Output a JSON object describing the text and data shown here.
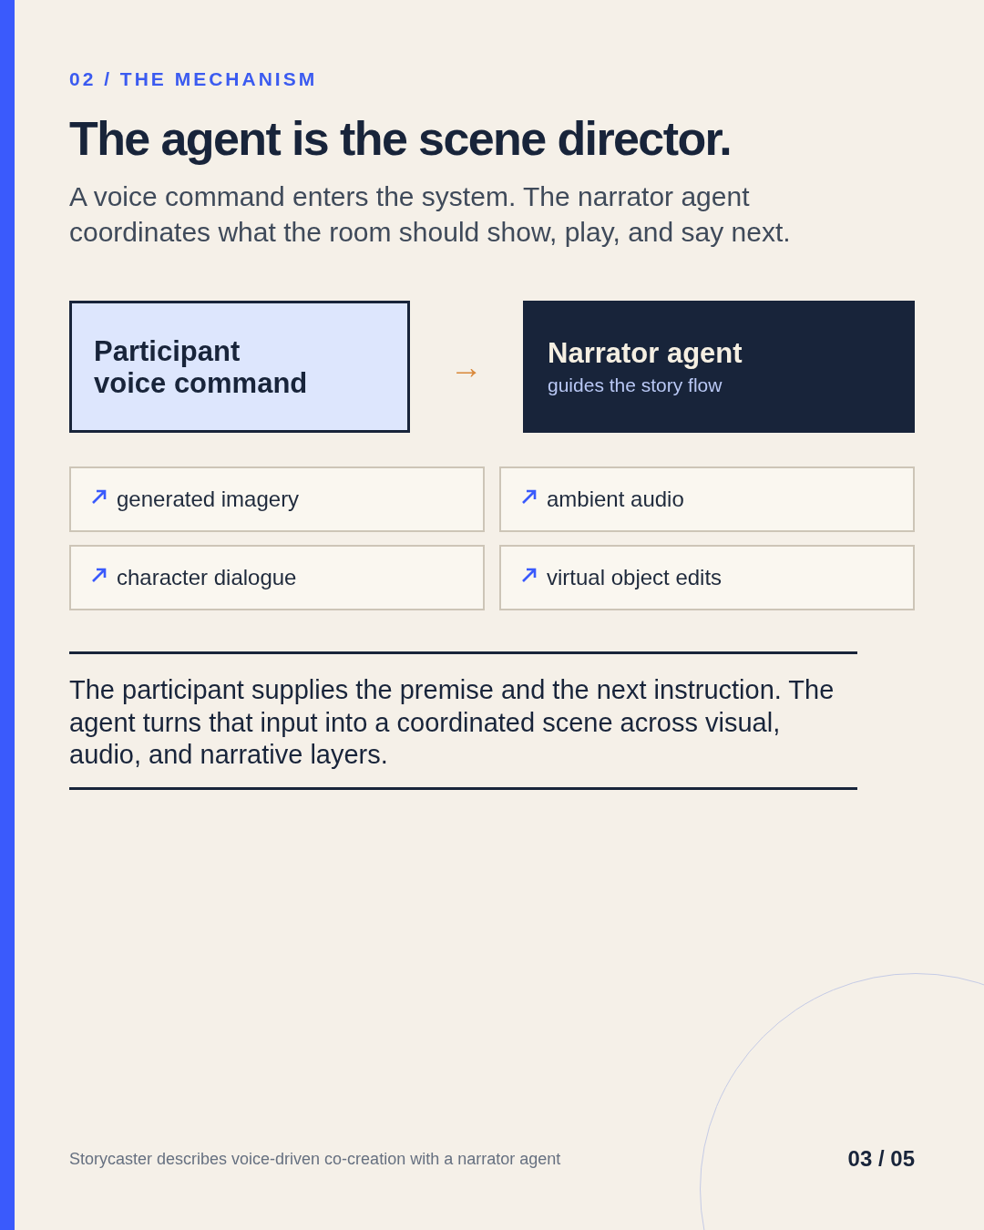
{
  "eyebrow": "02 / THE MECHANISM",
  "title": "The agent is the scene director.",
  "lead": "A voice command enters the system. The narrator agent coordinates what the room should show, play, and say next.",
  "flow": {
    "source": {
      "title": "Participant\nvoice command"
    },
    "connector": "→",
    "target": {
      "title": "Narrator agent",
      "subtitle": "guides the story flow"
    }
  },
  "outputs": [
    {
      "label": "generated imagery"
    },
    {
      "label": "ambient audio"
    },
    {
      "label": "character dialogue"
    },
    {
      "label": "virtual object edits"
    }
  ],
  "summary": "The participant supplies the premise and the next instruction. The agent turns that input into a coordinated scene across visual, audio, and narrative layers.",
  "footer": {
    "caption": "Storycaster describes voice-driven co-creation with a narrator agent",
    "page": "03 / 05"
  }
}
